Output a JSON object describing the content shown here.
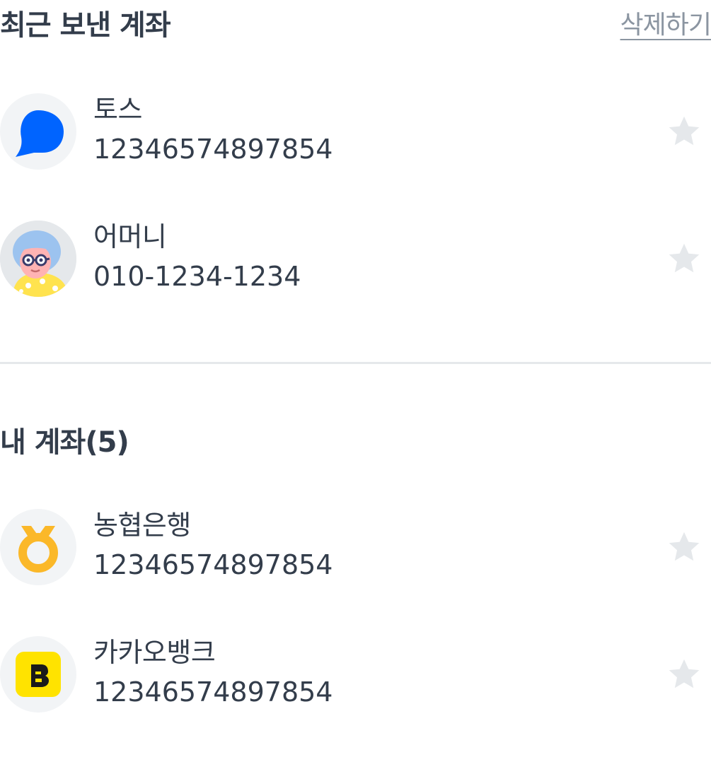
{
  "recent": {
    "title": "최근 보낸 계좌",
    "delete_label": "삭제하기",
    "accounts": [
      {
        "name": "토스",
        "number": "12346574897854",
        "icon": "toss-logo-icon",
        "favorite": false
      },
      {
        "name": "어머니",
        "number": "010-1234-1234",
        "icon": "mother-avatar-icon",
        "favorite": false
      }
    ]
  },
  "mine": {
    "title": "내 계좌(5)",
    "accounts": [
      {
        "name": "농협은행",
        "number": "12346574897854",
        "icon": "nonghyup-logo-icon",
        "favorite": false
      },
      {
        "name": "카카오뱅크",
        "number": "12346574897854",
        "icon": "kakaobank-logo-icon",
        "favorite": false
      }
    ]
  },
  "colors": {
    "text": "#333d4b",
    "subtle_text": "#8b95a1",
    "star_inactive": "#e5e8eb",
    "toss_blue": "#0064ff",
    "nonghyup_yellow": "#fbb829",
    "kakao_yellow": "#ffe300",
    "divider": "#e5e8eb"
  }
}
